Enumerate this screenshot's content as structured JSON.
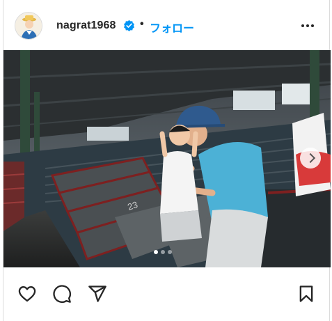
{
  "post": {
    "username": "nagrat1968",
    "follow_label": "フォロー",
    "separator": "•",
    "verified": true
  },
  "icons": {
    "heart": "heart-icon",
    "comment": "comment-icon",
    "share": "paper-plane-icon",
    "save": "bookmark-icon",
    "more": "more-horizontal-icon",
    "verified": "verified-badge-icon",
    "next": "chevron-right-icon"
  },
  "carousel": {
    "count": 3,
    "active": 1
  },
  "colors": {
    "accent": "#0095f6",
    "text": "#262626",
    "border": "#dbdbdb"
  }
}
